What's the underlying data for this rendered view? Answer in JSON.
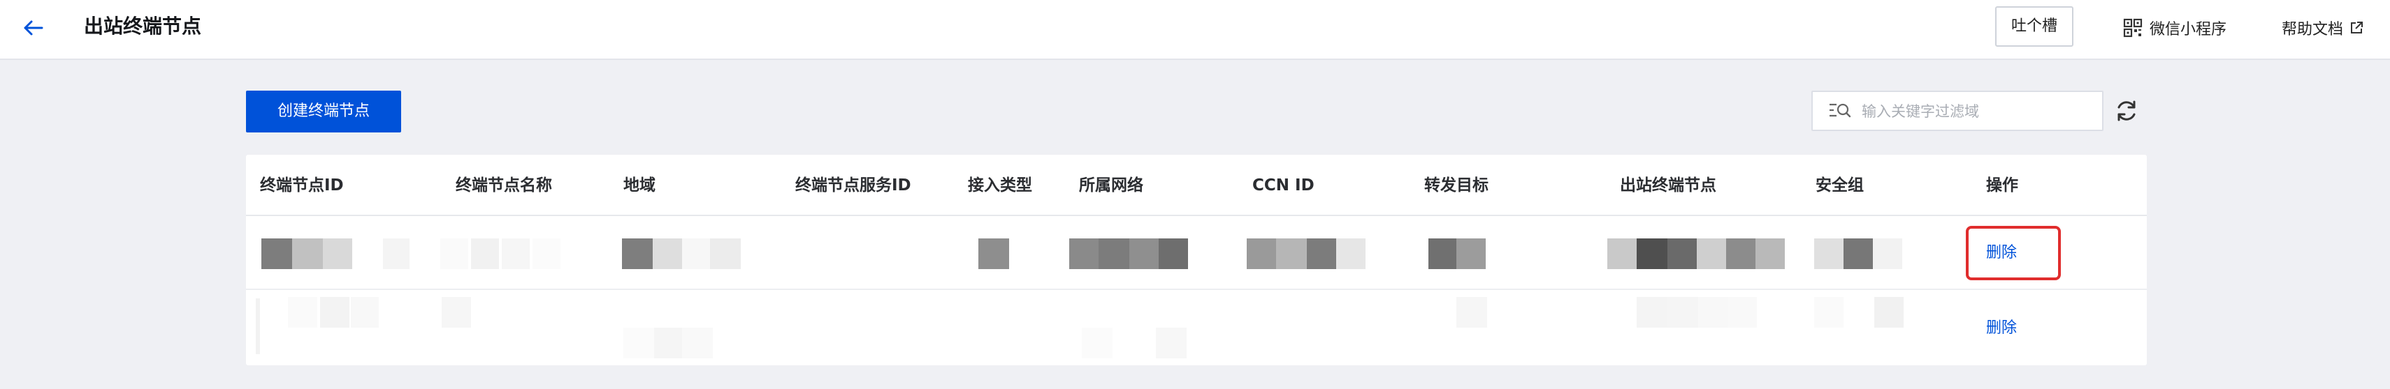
{
  "header": {
    "title": "出站终端节点",
    "feedback_label": "吐个槽",
    "mini_program_label": "微信小程序",
    "help_label": "帮助文档"
  },
  "toolbar": {
    "create_label": "创建终端节点",
    "search_placeholder": "输入关键字过滤域"
  },
  "table": {
    "columns": [
      "终端节点ID",
      "终端节点名称",
      "地域",
      "终端节点服务ID",
      "接入类型",
      "所属网络",
      "CCN ID",
      "转发目标",
      "出站终端节点",
      "安全组",
      "操作"
    ],
    "rows": [
      {
        "action": "删除"
      },
      {
        "action": "删除"
      }
    ]
  },
  "colors": {
    "primary": "#0052d9",
    "highlight": "#e02d2d",
    "background": "#eff0f4"
  }
}
